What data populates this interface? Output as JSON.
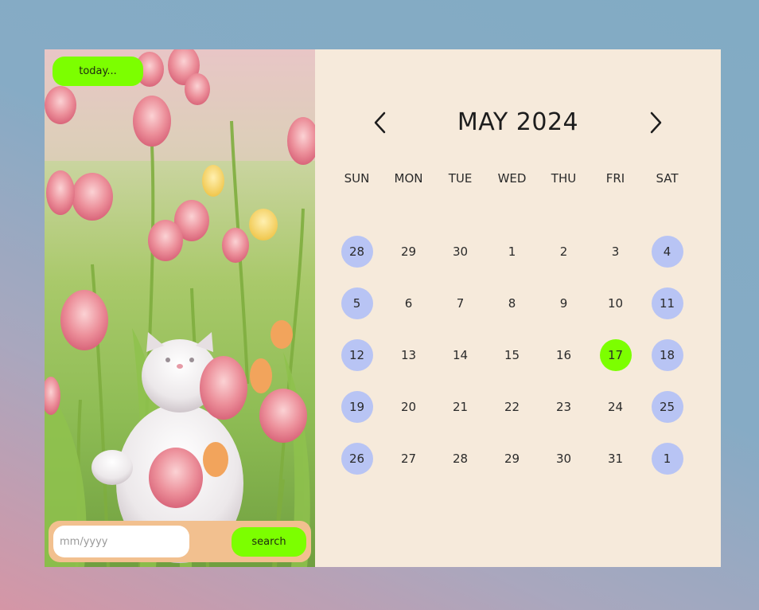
{
  "today_button": "today...",
  "search": {
    "placeholder": "mm/yyyy",
    "value": "",
    "button_label": "search"
  },
  "calendar": {
    "title": "MAY 2024",
    "prev_icon": "chevron-left-icon",
    "next_icon": "chevron-right-icon",
    "weekdays": [
      "SUN",
      "MON",
      "TUE",
      "WED",
      "THU",
      "FRI",
      "SAT"
    ],
    "weeks": [
      [
        "28",
        "29",
        "30",
        "1",
        "2",
        "3",
        "4"
      ],
      [
        "5",
        "6",
        "7",
        "8",
        "9",
        "10",
        "11"
      ],
      [
        "12",
        "13",
        "14",
        "15",
        "16",
        "17",
        "18"
      ],
      [
        "19",
        "20",
        "21",
        "22",
        "23",
        "24",
        "25"
      ],
      [
        "26",
        "27",
        "28",
        "29",
        "30",
        "31",
        "1"
      ]
    ],
    "today_date": "17"
  },
  "colors": {
    "accent_green": "#7cff00",
    "weekend_circle": "#b8c4f4",
    "panel_bg": "#f6eadb",
    "search_bar_bg": "#f2c08f"
  }
}
